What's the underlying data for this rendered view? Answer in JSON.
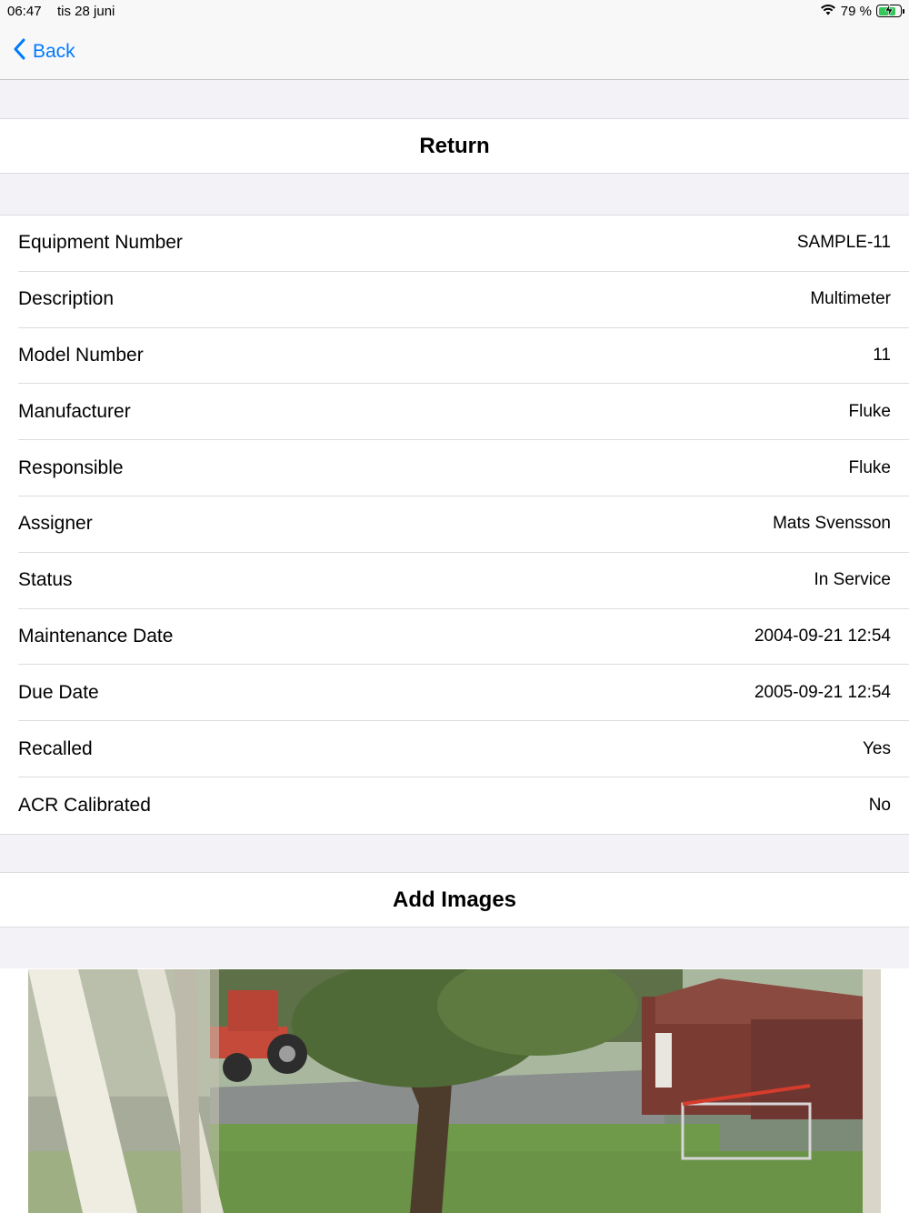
{
  "status_bar": {
    "time": "06:47",
    "date": "tis 28 juni",
    "battery": "79 %",
    "battery_level": 0.79
  },
  "nav": {
    "back_label": "Back"
  },
  "actions": {
    "return_label": "Return",
    "add_images_label": "Add Images"
  },
  "details": [
    {
      "label": "Equipment Number",
      "value": "SAMPLE-11"
    },
    {
      "label": "Description",
      "value": "Multimeter"
    },
    {
      "label": "Model Number",
      "value": "11"
    },
    {
      "label": "Manufacturer",
      "value": "Fluke"
    },
    {
      "label": "Responsible",
      "value": "Fluke"
    },
    {
      "label": "Assigner",
      "value": "Mats Svensson"
    },
    {
      "label": "Status",
      "value": "In Service"
    },
    {
      "label": "Maintenance Date",
      "value": "2004-09-21 12:54"
    },
    {
      "label": "Due Date",
      "value": "2005-09-21 12:54"
    },
    {
      "label": "Recalled",
      "value": "Yes"
    },
    {
      "label": "ACR Calibrated",
      "value": "No"
    }
  ],
  "colors": {
    "accent": "#007aff",
    "background": "#f2f2f7",
    "battery": "#34c759"
  }
}
